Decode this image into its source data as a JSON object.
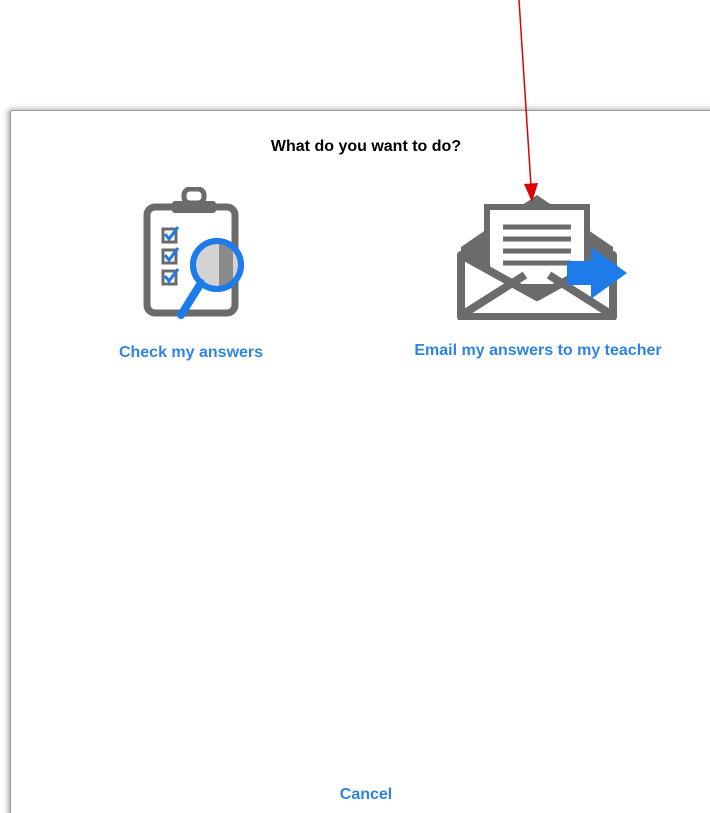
{
  "dialog": {
    "title": "What do you want to do?",
    "options": [
      {
        "label": "Check my answers",
        "icon": "clipboard-magnifier-icon"
      },
      {
        "label": "Email my answers to my teacher",
        "icon": "envelope-send-icon"
      }
    ],
    "cancel_label": "Cancel"
  },
  "colors": {
    "accent": "#2e84e2",
    "icon_gray": "#6b6b6b",
    "icon_blue": "#1e7bea",
    "annotation": "#e00000"
  }
}
